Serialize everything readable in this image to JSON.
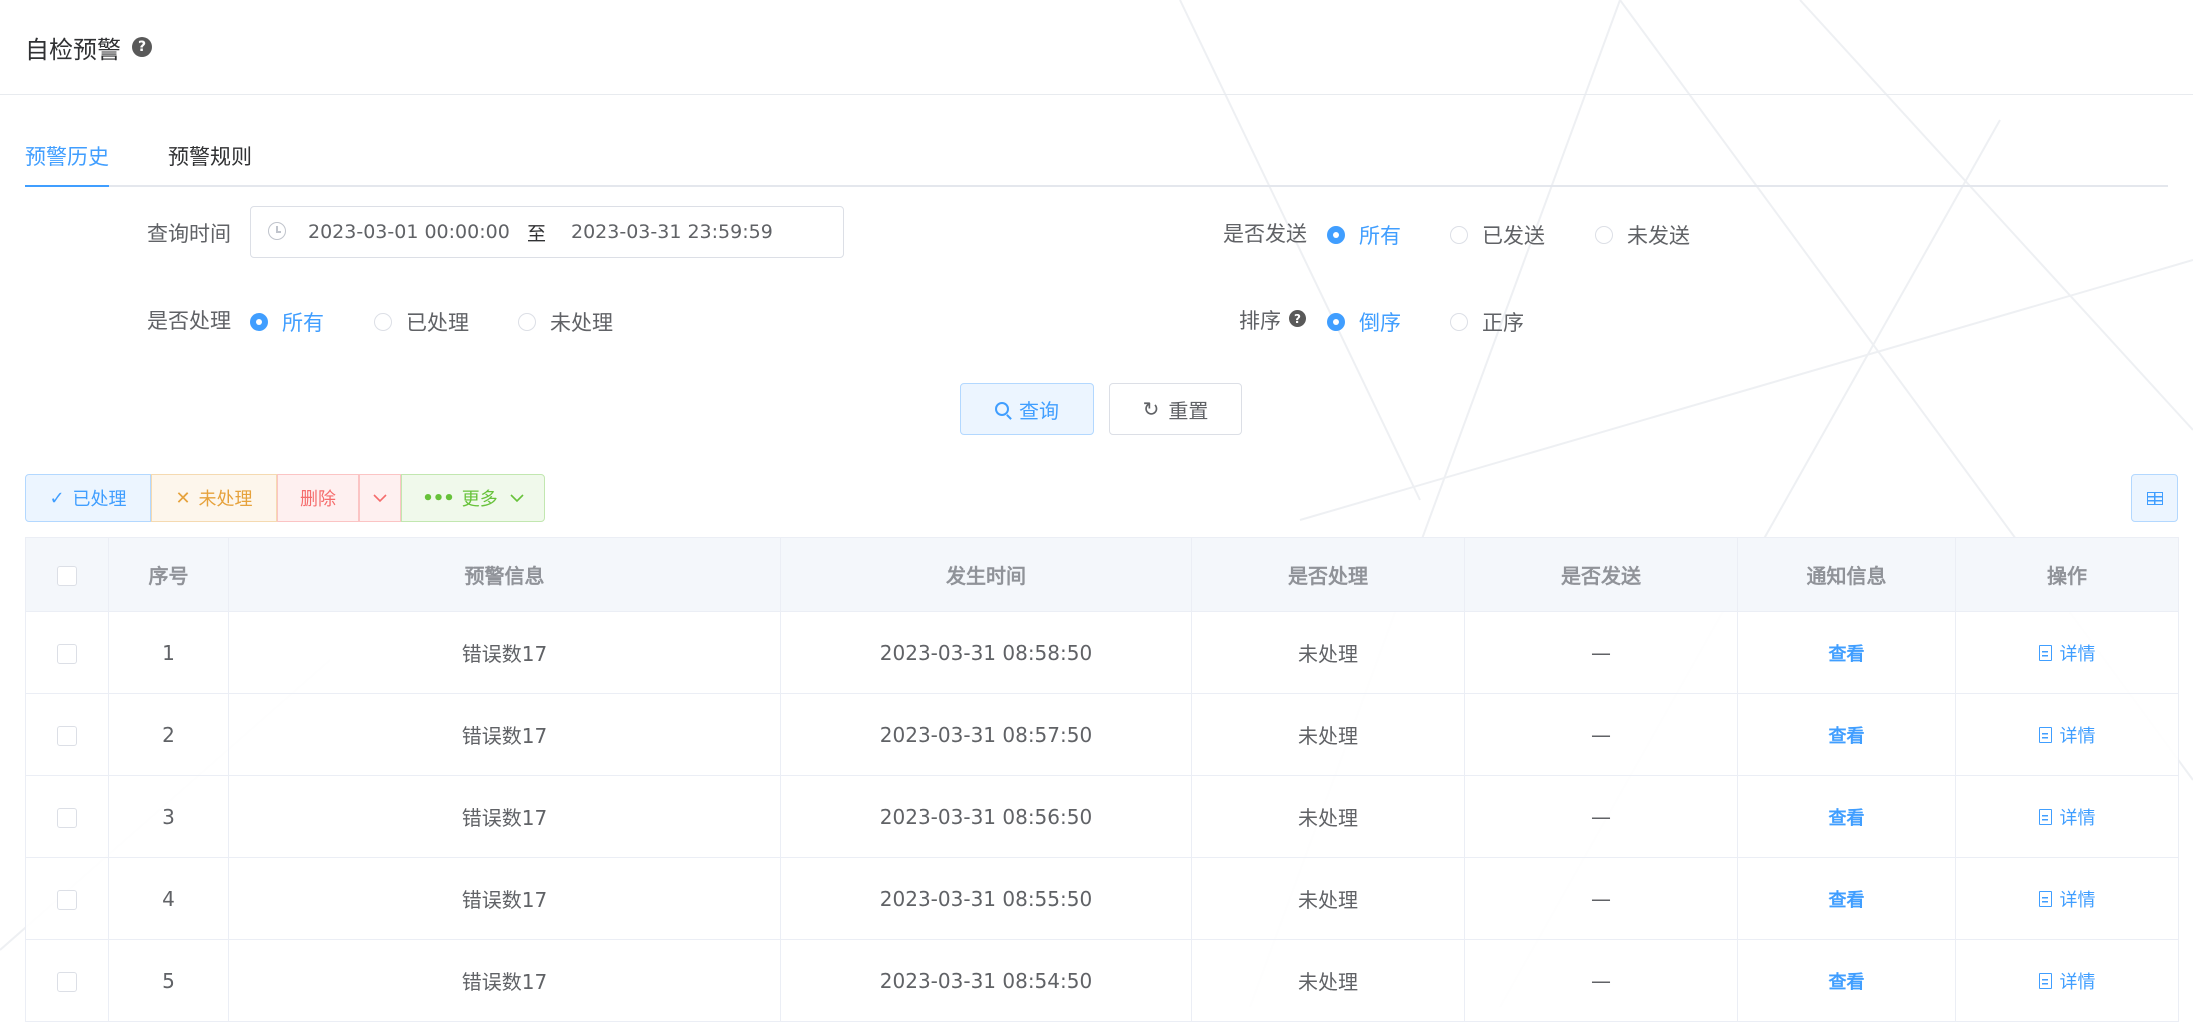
{
  "header": {
    "title": "自检预警",
    "help_icon": "question-circle-icon"
  },
  "tabs": [
    {
      "label": "预警历史",
      "active": true
    },
    {
      "label": "预警规则",
      "active": false
    }
  ],
  "filters": {
    "query_time": {
      "label": "查询时间",
      "start": "2023-03-01 00:00:00",
      "separator": "至",
      "end": "2023-03-31 23:59:59"
    },
    "sent": {
      "label": "是否发送",
      "options": [
        "所有",
        "已发送",
        "未发送"
      ],
      "selected": "所有"
    },
    "handled": {
      "label": "是否处理",
      "options": [
        "所有",
        "已处理",
        "未处理"
      ],
      "selected": "所有"
    },
    "sort": {
      "label": "排序",
      "options": [
        "倒序",
        "正序"
      ],
      "selected": "倒序"
    }
  },
  "actions": {
    "query": "查询",
    "reset": "重置"
  },
  "toolbar": {
    "handled": "已处理",
    "unhandled": "未处理",
    "delete": "删除",
    "more": "更多"
  },
  "table": {
    "columns": [
      "序号",
      "预警信息",
      "发生时间",
      "是否处理",
      "是否发送",
      "通知信息",
      "操作"
    ],
    "rows": [
      {
        "index": "1",
        "info": "错误数17",
        "time": "2023-03-31 08:58:50",
        "handled": "未处理",
        "sent": "—",
        "notice": "查看",
        "op": "详情"
      },
      {
        "index": "2",
        "info": "错误数17",
        "time": "2023-03-31 08:57:50",
        "handled": "未处理",
        "sent": "—",
        "notice": "查看",
        "op": "详情"
      },
      {
        "index": "3",
        "info": "错误数17",
        "time": "2023-03-31 08:56:50",
        "handled": "未处理",
        "sent": "—",
        "notice": "查看",
        "op": "详情"
      },
      {
        "index": "4",
        "info": "错误数17",
        "time": "2023-03-31 08:55:50",
        "handled": "未处理",
        "sent": "—",
        "notice": "查看",
        "op": "详情"
      },
      {
        "index": "5",
        "info": "错误数17",
        "time": "2023-03-31 08:54:50",
        "handled": "未处理",
        "sent": "—",
        "notice": "查看",
        "op": "详情"
      }
    ]
  },
  "colors": {
    "primary": "#409eff",
    "danger": "#f56c6c",
    "warning": "#e6a23c",
    "success": "#67c23a"
  }
}
